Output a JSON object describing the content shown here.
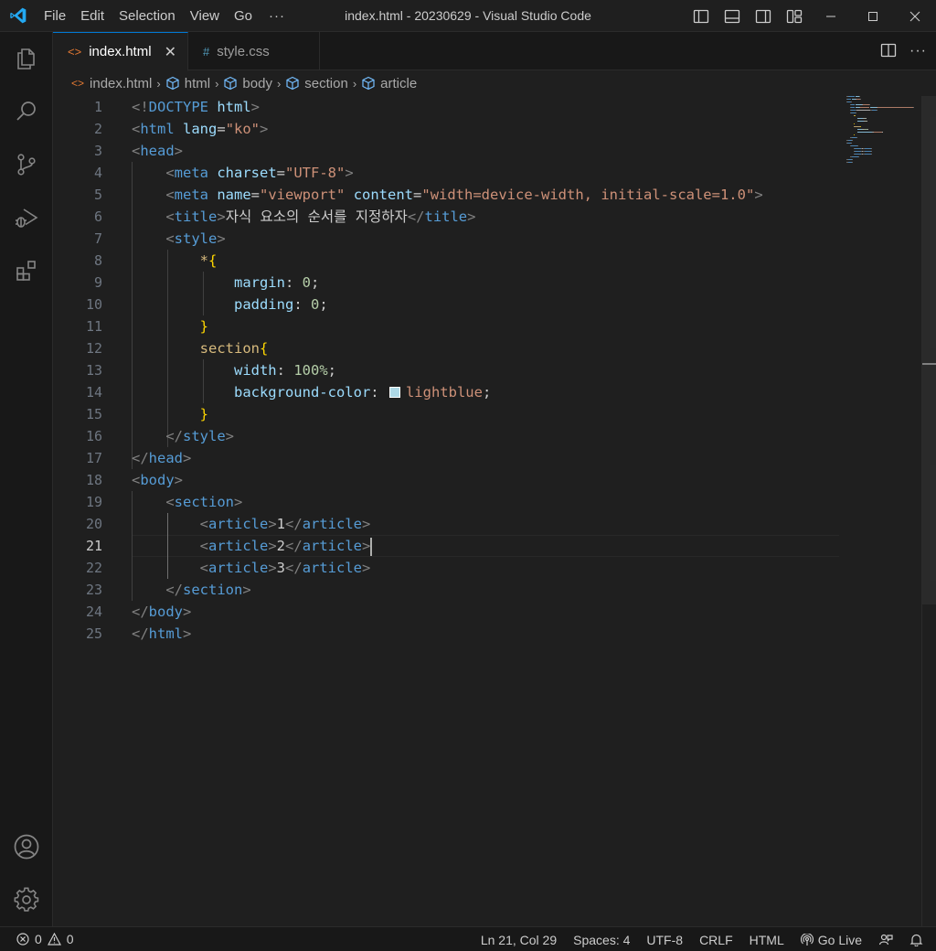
{
  "titlebar": {
    "window_title": "index.html - 20230629 - Visual Studio Code",
    "menu": [
      "File",
      "Edit",
      "Selection",
      "View",
      "Go"
    ],
    "more": "···",
    "logo_color": "#23a9f2"
  },
  "activity_bar": {
    "items": [
      "explorer-icon",
      "search-icon",
      "source-control-icon",
      "run-debug-icon",
      "extensions-icon"
    ],
    "bottom": [
      "account-icon",
      "manage-gear-icon"
    ]
  },
  "tabs": [
    {
      "label": "index.html",
      "icon": "<>",
      "icon_color": "#e37933",
      "active": true,
      "close": "✕"
    },
    {
      "label": "style.css",
      "icon": "#",
      "icon_color": "#519aba",
      "active": false
    }
  ],
  "breadcrumb": [
    "index.html",
    "html",
    "body",
    "section",
    "article"
  ],
  "editor": {
    "current_line": 21,
    "line_numbers": [
      "1",
      "2",
      "3",
      "4",
      "5",
      "6",
      "7",
      "8",
      "9",
      "10",
      "11",
      "12",
      "13",
      "14",
      "15",
      "16",
      "17",
      "18",
      "19",
      "20",
      "21",
      "22",
      "23",
      "24",
      "25"
    ],
    "lines": [
      [
        [
          "t-punc",
          "<!"
        ],
        [
          "t-tag",
          "DOCTYPE"
        ],
        [
          "t-text",
          " "
        ],
        [
          "t-attr",
          "html"
        ],
        [
          "t-punc",
          ">"
        ]
      ],
      [
        [
          "t-punc",
          "<"
        ],
        [
          "t-tag",
          "html"
        ],
        [
          "t-text",
          " "
        ],
        [
          "t-attr",
          "lang"
        ],
        [
          "t-text",
          "="
        ],
        [
          "t-str",
          "\"ko\""
        ],
        [
          "t-punc",
          ">"
        ]
      ],
      [
        [
          "t-punc",
          "<"
        ],
        [
          "t-tag",
          "head"
        ],
        [
          "t-punc",
          ">"
        ]
      ],
      [
        [
          "t-text",
          "    "
        ],
        [
          "t-punc",
          "<"
        ],
        [
          "t-tag",
          "meta"
        ],
        [
          "t-text",
          " "
        ],
        [
          "t-attr",
          "charset"
        ],
        [
          "t-text",
          "="
        ],
        [
          "t-str",
          "\"UTF-8\""
        ],
        [
          "t-punc",
          ">"
        ]
      ],
      [
        [
          "t-text",
          "    "
        ],
        [
          "t-punc",
          "<"
        ],
        [
          "t-tag",
          "meta"
        ],
        [
          "t-text",
          " "
        ],
        [
          "t-attr",
          "name"
        ],
        [
          "t-text",
          "="
        ],
        [
          "t-str",
          "\"viewport\""
        ],
        [
          "t-text",
          " "
        ],
        [
          "t-attr",
          "content"
        ],
        [
          "t-text",
          "="
        ],
        [
          "t-str",
          "\"width=device-width, initial-scale=1.0\""
        ],
        [
          "t-punc",
          ">"
        ]
      ],
      [
        [
          "t-text",
          "    "
        ],
        [
          "t-punc",
          "<"
        ],
        [
          "t-tag",
          "title"
        ],
        [
          "t-punc",
          ">"
        ],
        [
          "t-text",
          "자식 요소의 순서를 지정하자"
        ],
        [
          "t-punc",
          "</"
        ],
        [
          "t-tag",
          "title"
        ],
        [
          "t-punc",
          ">"
        ]
      ],
      [
        [
          "t-text",
          "    "
        ],
        [
          "t-punc",
          "<"
        ],
        [
          "t-tag",
          "style"
        ],
        [
          "t-punc",
          ">"
        ]
      ],
      [
        [
          "t-text",
          "        "
        ],
        [
          "t-sel",
          "*"
        ],
        [
          "t-brace",
          "{"
        ]
      ],
      [
        [
          "t-text",
          "            "
        ],
        [
          "t-prop",
          "margin"
        ],
        [
          "t-text",
          ": "
        ],
        [
          "t-num",
          "0"
        ],
        [
          "t-text",
          ";"
        ]
      ],
      [
        [
          "t-text",
          "            "
        ],
        [
          "t-prop",
          "padding"
        ],
        [
          "t-text",
          ": "
        ],
        [
          "t-num",
          "0"
        ],
        [
          "t-text",
          ";"
        ]
      ],
      [
        [
          "t-text",
          "        "
        ],
        [
          "t-brace",
          "}"
        ]
      ],
      [
        [
          "t-text",
          "        "
        ],
        [
          "t-sel",
          "section"
        ],
        [
          "t-brace",
          "{"
        ]
      ],
      [
        [
          "t-text",
          "            "
        ],
        [
          "t-prop",
          "width"
        ],
        [
          "t-text",
          ": "
        ],
        [
          "t-num",
          "100%"
        ],
        [
          "t-text",
          ";"
        ]
      ],
      [
        [
          "t-text",
          "            "
        ],
        [
          "t-prop",
          "background-color"
        ],
        [
          "t-text",
          ": "
        ],
        [
          "swatch",
          ""
        ],
        [
          "t-val",
          "lightblue"
        ],
        [
          "t-text",
          ";"
        ]
      ],
      [
        [
          "t-text",
          "        "
        ],
        [
          "t-brace",
          "}"
        ]
      ],
      [
        [
          "t-text",
          "    "
        ],
        [
          "t-punc",
          "</"
        ],
        [
          "t-tag",
          "style"
        ],
        [
          "t-punc",
          ">"
        ]
      ],
      [
        [
          "t-punc",
          "</"
        ],
        [
          "t-tag",
          "head"
        ],
        [
          "t-punc",
          ">"
        ]
      ],
      [
        [
          "t-punc",
          "<"
        ],
        [
          "t-tag",
          "body"
        ],
        [
          "t-punc",
          ">"
        ]
      ],
      [
        [
          "t-text",
          "    "
        ],
        [
          "t-punc",
          "<"
        ],
        [
          "t-tag",
          "section"
        ],
        [
          "t-punc",
          ">"
        ]
      ],
      [
        [
          "t-text",
          "        "
        ],
        [
          "t-punc",
          "<"
        ],
        [
          "t-tag",
          "article"
        ],
        [
          "t-punc",
          ">"
        ],
        [
          "t-text",
          "1"
        ],
        [
          "t-punc",
          "</"
        ],
        [
          "t-tag",
          "article"
        ],
        [
          "t-punc",
          ">"
        ]
      ],
      [
        [
          "t-text",
          "        "
        ],
        [
          "t-punc",
          "<"
        ],
        [
          "t-tag",
          "article"
        ],
        [
          "t-punc",
          ">"
        ],
        [
          "t-text",
          "2"
        ],
        [
          "t-punc",
          "</"
        ],
        [
          "t-tag",
          "article"
        ],
        [
          "t-punc",
          ">"
        ],
        [
          "cursor",
          ""
        ]
      ],
      [
        [
          "t-text",
          "        "
        ],
        [
          "t-punc",
          "<"
        ],
        [
          "t-tag",
          "article"
        ],
        [
          "t-punc",
          ">"
        ],
        [
          "t-text",
          "3"
        ],
        [
          "t-punc",
          "</"
        ],
        [
          "t-tag",
          "article"
        ],
        [
          "t-punc",
          ">"
        ]
      ],
      [
        [
          "t-text",
          "    "
        ],
        [
          "t-punc",
          "</"
        ],
        [
          "t-tag",
          "section"
        ],
        [
          "t-punc",
          ">"
        ]
      ],
      [
        [
          "t-punc",
          "</"
        ],
        [
          "t-tag",
          "body"
        ],
        [
          "t-punc",
          ">"
        ]
      ],
      [
        [
          "t-punc",
          "</"
        ],
        [
          "t-tag",
          "html"
        ],
        [
          "t-punc",
          ">"
        ]
      ]
    ]
  },
  "status": {
    "errors": "0",
    "warnings": "0",
    "position": "Ln 21, Col 29",
    "spaces": "Spaces: 4",
    "encoding": "UTF-8",
    "eol": "CRLF",
    "language": "HTML",
    "golive": "Go Live"
  },
  "colors": {
    "accent": "#0078d4",
    "swatch_lightblue": "#add8e6"
  }
}
